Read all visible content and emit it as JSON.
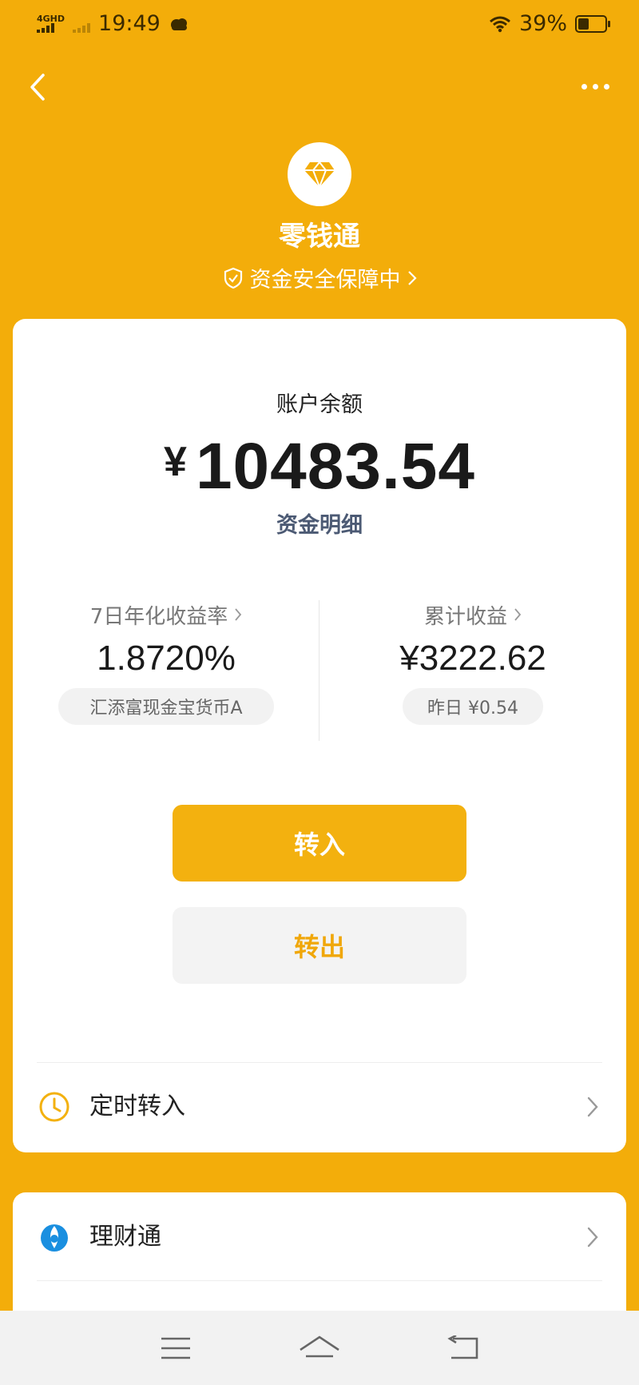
{
  "status": {
    "network_label": "4GHD",
    "time": "19:49",
    "battery": "39%"
  },
  "header": {
    "title": "零钱通",
    "safety_text": "资金安全保障中"
  },
  "balance": {
    "label": "账户余额",
    "currency": "¥",
    "amount": "10483.54",
    "detail_link": "资金明细"
  },
  "stats": {
    "yield": {
      "label": "7日年化收益率",
      "value": "1.8720%",
      "fund": "汇添富现金宝货币A"
    },
    "total": {
      "label": "累计收益",
      "value": "¥3222.62",
      "yesterday": "昨日 ¥0.54"
    }
  },
  "actions": {
    "transfer_in": "转入",
    "transfer_out": "转出"
  },
  "rows": {
    "scheduled": "定时转入",
    "licaitong": "理财通"
  },
  "colors": {
    "brand": "#F3AD0A",
    "button": "#F3B10F"
  },
  "icons": [
    "back-icon",
    "more-icon",
    "diamond-icon",
    "shield-icon",
    "clock-icon",
    "licaitong-icon",
    "chevron-right-icon",
    "menu-icon",
    "home-icon",
    "return-icon"
  ]
}
